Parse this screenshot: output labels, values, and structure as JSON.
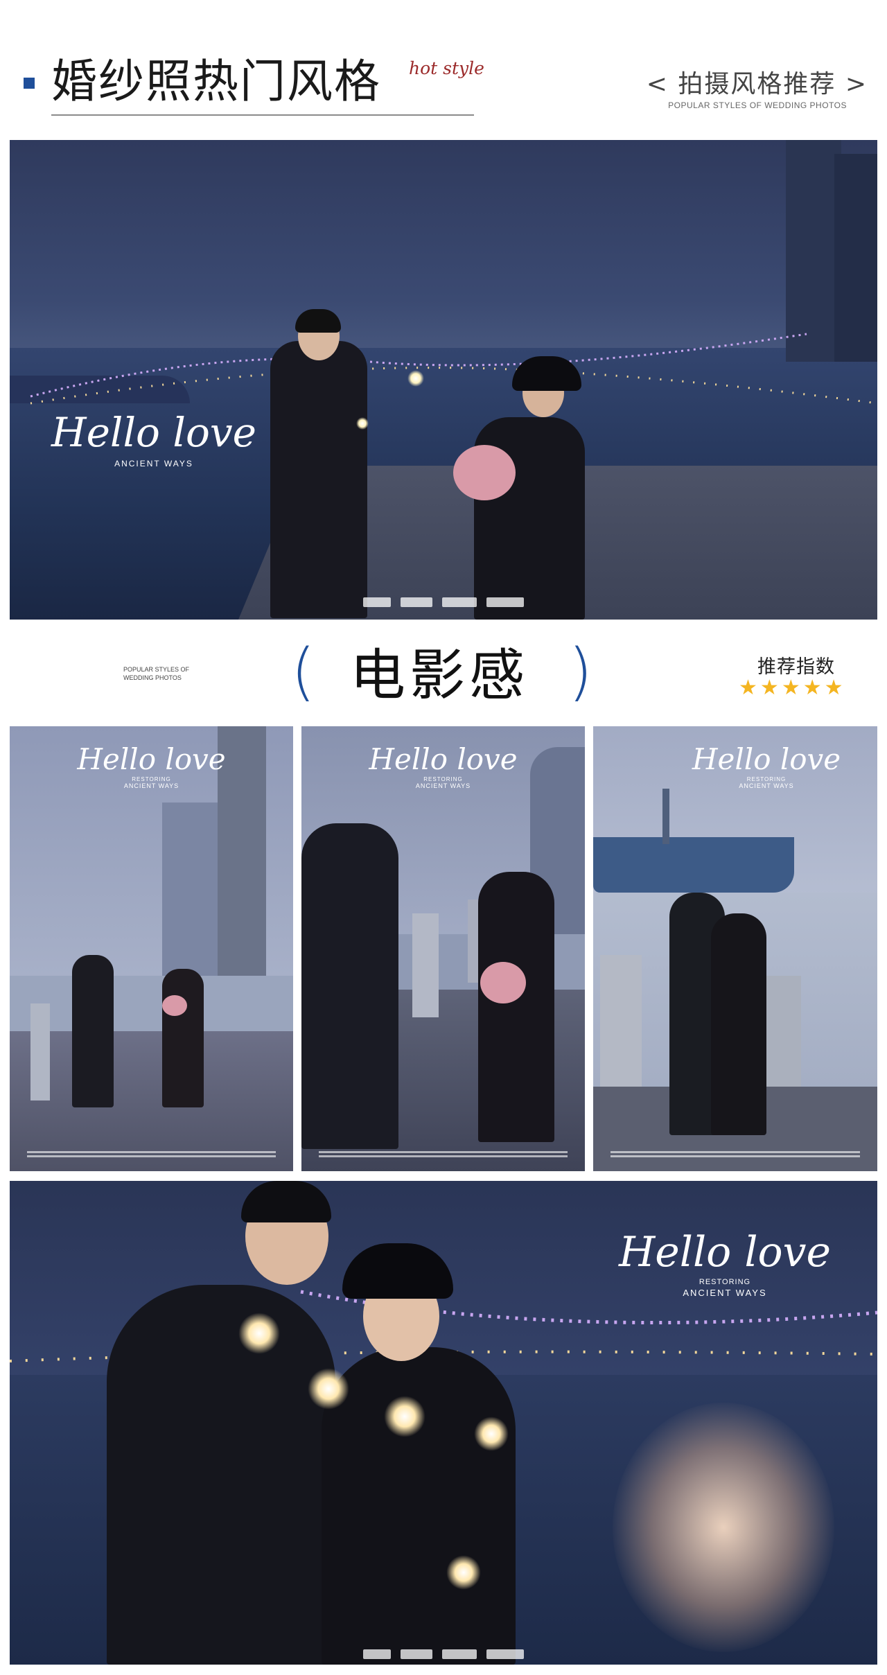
{
  "header": {
    "title": "婚纱照热门风格",
    "subtitle": "hot style",
    "recommend_title": "< 拍摄风格推荐 >",
    "recommend_subtitle": "POPULAR STYLES OF WEDDING PHOTOS",
    "accent_color": "#1f4f9a",
    "subtitle_color": "#9b2a2a"
  },
  "photos": {
    "overlay_script": "Hello love",
    "overlay_line1": "RESTORING",
    "overlay_line2": "ANCIENT WAYS"
  },
  "section": {
    "small_text": "POPULAR STYLES OF WEDDING PHOTOS",
    "paren_open": "(",
    "title": "电影感",
    "paren_close": ")",
    "rating_label": "推荐指数",
    "rating": 5,
    "rating_max": 5,
    "star_glyph": "★",
    "star_color": "#f4b521"
  }
}
